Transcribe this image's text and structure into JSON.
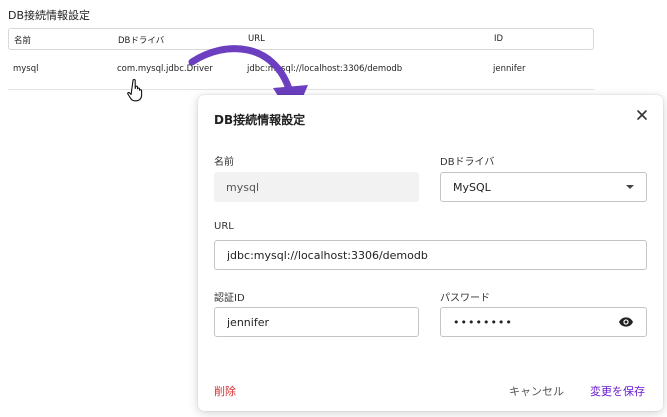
{
  "page": {
    "title": "DB接続情報設定"
  },
  "table": {
    "columns": [
      "名前",
      "DBドライバ",
      "URL",
      "ID"
    ],
    "rows": [
      {
        "name": "mysql",
        "driver": "com.mysql.jdbc.Driver",
        "url": "jdbc:mysql://localhost:3306/demodb",
        "id": "jennifer"
      }
    ]
  },
  "dialog": {
    "title": "DB接続情報設定",
    "fields": {
      "name": {
        "label": "名前",
        "value": "mysql"
      },
      "driver": {
        "label": "DBドライバ",
        "value": "MySQL"
      },
      "url": {
        "label": "URL",
        "value": "jdbc:mysql://localhost:3306/demodb"
      },
      "auth_id": {
        "label": "認証ID",
        "value": "jennifer"
      },
      "password": {
        "label": "パスワード",
        "value": "••••••••"
      }
    },
    "buttons": {
      "delete": "削除",
      "cancel": "キャンセル",
      "save": "変更を保存"
    }
  },
  "colors": {
    "accent": "#6a1bd1",
    "danger": "#d32f2f",
    "arrow": "#6b3fc0"
  },
  "icons": [
    "pointer-hand-icon",
    "curved-arrow-icon",
    "close-icon",
    "chevron-down-icon",
    "eye-icon"
  ]
}
